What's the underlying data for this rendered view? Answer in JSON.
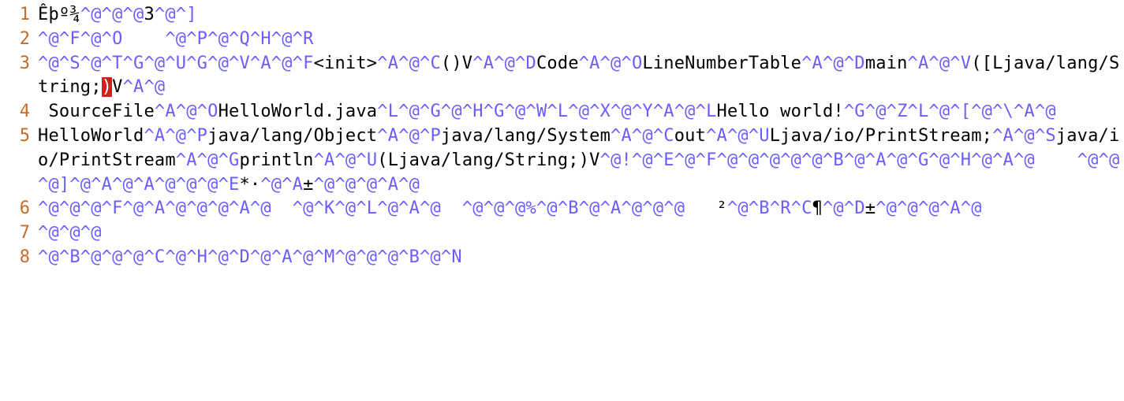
{
  "gutter": {
    "line1": "1",
    "line2": "2",
    "line3": "3",
    "line4": "4",
    "line5": "5",
    "line6": "6",
    "line7": "7",
    "line8": "8"
  },
  "l1": {
    "a": "Êþº¾",
    "b": "^@^@^@",
    "c": "3",
    "d": "^@^]"
  },
  "l2": {
    "a": "^@^F^@^O",
    "sp1": "    ",
    "b": "^@^P^@^Q^H^@^R"
  },
  "l3": {
    "a": "^@^S^@^T^G^@^U^G^@^V^A^@^F",
    "b": "<init>",
    "c": "^A^@^C",
    "d": "()V",
    "e": "^A^@^D",
    "f": "Code",
    "g": "^A^@^O",
    "h": "LineNumberTable",
    "i": "^A^@^D",
    "j": "main",
    "k": "^A^@^V",
    "l": "([Ljava/lang/String;",
    "m": ")",
    "n": "V",
    "o": "^A^@"
  },
  "l4": {
    "sp0": " ",
    "a": "SourceFile",
    "b": "^A^@^O",
    "c": "HelloWorld.java",
    "d": "^L^@^G^@^H^G^@^W^L^@^X^@^Y^A^@^L",
    "e": "Hello world!",
    "f": "^G^@^Z^L^@^[^@^\\^A^@"
  },
  "l5": {
    "a": "HelloWorld",
    "b": "^A^@^P",
    "c": "java/lang/Object",
    "d": "^A^@^P",
    "e": "java/lang/System",
    "f": "^A^@^C",
    "g": "out",
    "h": "^A^@^U",
    "i": "Ljava/io/PrintStream;",
    "j": "^A^@^S",
    "k": "java/io/PrintStream",
    "l": "^A^@^G",
    "m": "println",
    "n": "^A^@^U",
    "o": "(Ljava/lang/String;)V",
    "p": "^@!^@^E^@^F^@^@^@^@^@^B^@^A^@^G^@^H^@^A^@",
    "sp1": "    ",
    "q": "^@^@^@]^@^A^@^A^@^@^@^E",
    "r": "*·",
    "s": "^@^A",
    "t": "±",
    "u": "^@^@^@^A^@"
  },
  "l6": {
    "a": "^@^@^@^F^@^A^@^@^@^A^@",
    "sp1": "  ",
    "b": "^@^K^@^L^@^A^@",
    "sp2": "  ",
    "c": "^@^@^@%^@^B^@^A^@^@^@",
    "sp3": "   ",
    "d": "²",
    "e": "^@^B^R^C",
    "f": "¶",
    "g": "^@^D",
    "h": "±",
    "i": "^@^@^@^A^@"
  },
  "l7": {
    "a": "^@^@^@"
  },
  "l8": {
    "a": "^@^B^@^@^@^C^@^H^@^D^@^A^@^M^@^@^@^B^@^N"
  }
}
